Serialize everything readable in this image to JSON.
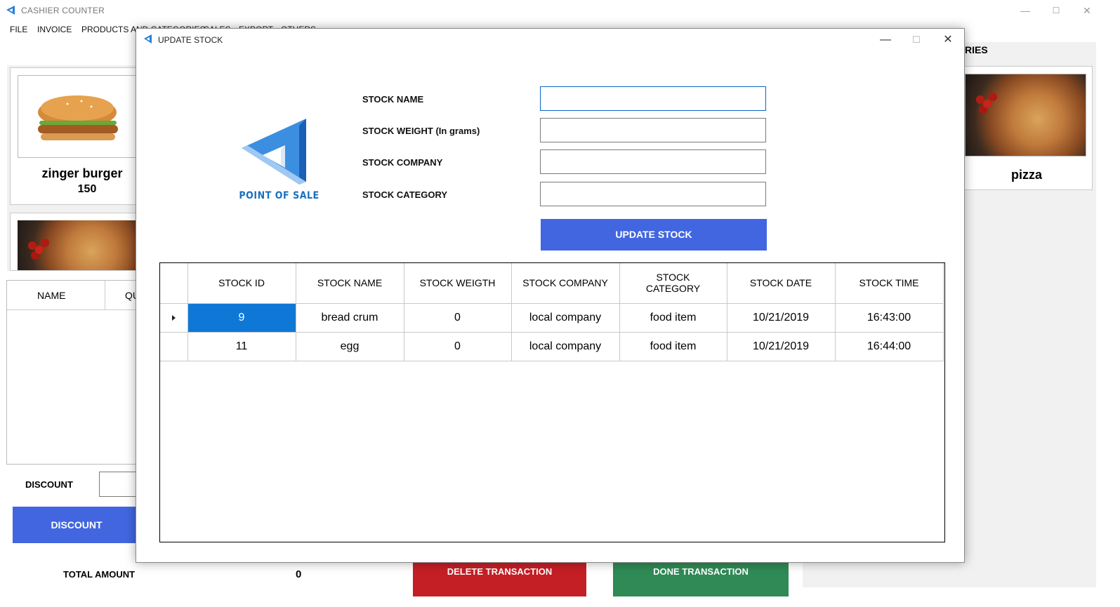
{
  "app": {
    "title": "CASHIER COUNTER",
    "minimize": "—",
    "maximize": "☐",
    "close": "✕"
  },
  "menu": [
    "FILE",
    "INVOICE",
    "PRODUCTS AND CATEGORIES",
    "SALES",
    "EXPORT",
    "OTHERS"
  ],
  "background": {
    "right_header_partial": "RIES",
    "products": [
      {
        "name": "zinger burger",
        "price": "150"
      },
      {
        "name": "pizza",
        "price": ""
      }
    ],
    "cart_columns": [
      "NAME",
      "QU"
    ],
    "discount_label": "DISCOUNT",
    "discount_button": "DISCOUNT",
    "total_amount_label": "TOTAL AMOUNT",
    "total_amount_value": "0",
    "delete_button": "DELETE TRANSACTION",
    "done_button": "DONE TRANSACTION"
  },
  "dialog": {
    "title": "UPDATE STOCK",
    "minimize": "—",
    "maximize": "☐",
    "close": "✕",
    "logo_text": "POINT OF SALE",
    "fields": [
      {
        "label": "STOCK NAME",
        "value": ""
      },
      {
        "label": "STOCK WEIGHT (In grams)",
        "value": ""
      },
      {
        "label": "STOCK COMPANY",
        "value": ""
      },
      {
        "label": "STOCK CATEGORY",
        "value": ""
      }
    ],
    "update_button": "UPDATE STOCK",
    "grid": {
      "columns": [
        "STOCK ID",
        "STOCK NAME",
        "STOCK WEIGTH",
        "STOCK COMPANY",
        "STOCK CATEGORY",
        "STOCK DATE",
        "STOCK TIME"
      ],
      "rows": [
        [
          "9",
          "bread crum",
          "0",
          "local company",
          "food item",
          "10/21/2019",
          "16:43:00"
        ],
        [
          "11",
          "egg",
          "0",
          "local company",
          "food item",
          "10/21/2019",
          "16:44:00"
        ]
      ],
      "selected_row": 0
    }
  }
}
